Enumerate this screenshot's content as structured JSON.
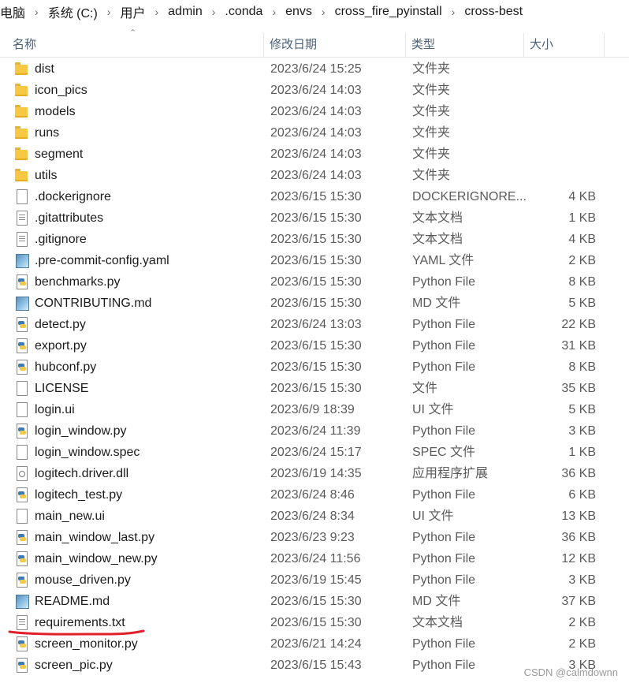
{
  "breadcrumb": {
    "items": [
      "电脑",
      "系统 (C:)",
      "用户",
      "admin",
      ".conda",
      "envs",
      "cross_fire_pyinstall",
      "cross-best"
    ],
    "separator": "›"
  },
  "columns": {
    "name": "名称",
    "date": "修改日期",
    "type": "类型",
    "size": "大小"
  },
  "sort_icon": "chevron-up-icon",
  "files": [
    {
      "name": "dist",
      "date": "2023/6/24 15:25",
      "type": "文件夹",
      "size": "",
      "icon": "folder"
    },
    {
      "name": "icon_pics",
      "date": "2023/6/24 14:03",
      "type": "文件夹",
      "size": "",
      "icon": "folder"
    },
    {
      "name": "models",
      "date": "2023/6/24 14:03",
      "type": "文件夹",
      "size": "",
      "icon": "folder"
    },
    {
      "name": "runs",
      "date": "2023/6/24 14:03",
      "type": "文件夹",
      "size": "",
      "icon": "folder"
    },
    {
      "name": "segment",
      "date": "2023/6/24 14:03",
      "type": "文件夹",
      "size": "",
      "icon": "folder"
    },
    {
      "name": "utils",
      "date": "2023/6/24 14:03",
      "type": "文件夹",
      "size": "",
      "icon": "folder"
    },
    {
      "name": ".dockerignore",
      "date": "2023/6/15 15:30",
      "type": "DOCKERIGNORE...",
      "size": "4 KB",
      "icon": "doc"
    },
    {
      "name": ".gitattributes",
      "date": "2023/6/15 15:30",
      "type": "文本文档",
      "size": "1 KB",
      "icon": "text"
    },
    {
      "name": ".gitignore",
      "date": "2023/6/15 15:30",
      "type": "文本文档",
      "size": "4 KB",
      "icon": "text"
    },
    {
      "name": ".pre-commit-config.yaml",
      "date": "2023/6/15 15:30",
      "type": "YAML 文件",
      "size": "2 KB",
      "icon": "md"
    },
    {
      "name": "benchmarks.py",
      "date": "2023/6/15 15:30",
      "type": "Python File",
      "size": "8 KB",
      "icon": "py"
    },
    {
      "name": "CONTRIBUTING.md",
      "date": "2023/6/15 15:30",
      "type": "MD 文件",
      "size": "5 KB",
      "icon": "md"
    },
    {
      "name": "detect.py",
      "date": "2023/6/24 13:03",
      "type": "Python File",
      "size": "22 KB",
      "icon": "py"
    },
    {
      "name": "export.py",
      "date": "2023/6/15 15:30",
      "type": "Python File",
      "size": "31 KB",
      "icon": "py"
    },
    {
      "name": "hubconf.py",
      "date": "2023/6/15 15:30",
      "type": "Python File",
      "size": "8 KB",
      "icon": "py"
    },
    {
      "name": "LICENSE",
      "date": "2023/6/15 15:30",
      "type": "文件",
      "size": "35 KB",
      "icon": "doc"
    },
    {
      "name": "login.ui",
      "date": "2023/6/9 18:39",
      "type": "UI 文件",
      "size": "5 KB",
      "icon": "doc"
    },
    {
      "name": "login_window.py",
      "date": "2023/6/24 11:39",
      "type": "Python File",
      "size": "3 KB",
      "icon": "py"
    },
    {
      "name": "login_window.spec",
      "date": "2023/6/24 15:17",
      "type": "SPEC 文件",
      "size": "1 KB",
      "icon": "doc"
    },
    {
      "name": "logitech.driver.dll",
      "date": "2023/6/19 14:35",
      "type": "应用程序扩展",
      "size": "36 KB",
      "icon": "dll"
    },
    {
      "name": "logitech_test.py",
      "date": "2023/6/24 8:46",
      "type": "Python File",
      "size": "6 KB",
      "icon": "py"
    },
    {
      "name": "main_new.ui",
      "date": "2023/6/24 8:34",
      "type": "UI 文件",
      "size": "13 KB",
      "icon": "doc"
    },
    {
      "name": "main_window_last.py",
      "date": "2023/6/23 9:23",
      "type": "Python File",
      "size": "36 KB",
      "icon": "py"
    },
    {
      "name": "main_window_new.py",
      "date": "2023/6/24 11:56",
      "type": "Python File",
      "size": "12 KB",
      "icon": "py"
    },
    {
      "name": "mouse_driven.py",
      "date": "2023/6/19 15:45",
      "type": "Python File",
      "size": "3 KB",
      "icon": "py"
    },
    {
      "name": "README.md",
      "date": "2023/6/15 15:30",
      "type": "MD 文件",
      "size": "37 KB",
      "icon": "md"
    },
    {
      "name": "requirements.txt",
      "date": "2023/6/15 15:30",
      "type": "文本文档",
      "size": "2 KB",
      "icon": "text"
    },
    {
      "name": "screen_monitor.py",
      "date": "2023/6/21 14:24",
      "type": "Python File",
      "size": "2 KB",
      "icon": "py"
    },
    {
      "name": "screen_pic.py",
      "date": "2023/6/15 15:43",
      "type": "Python File",
      "size": "3 KB",
      "icon": "py"
    }
  ],
  "annotation_color": "#e0202a",
  "watermark": "CSDN @calmdownn"
}
